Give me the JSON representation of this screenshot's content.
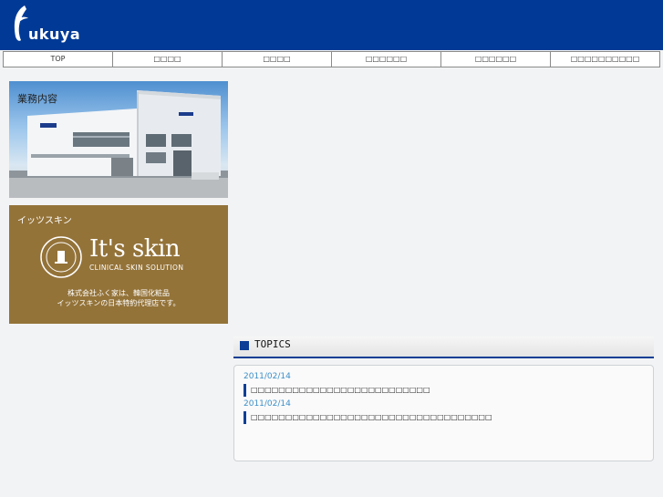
{
  "brand": {
    "logo_text": "ukuya"
  },
  "nav": {
    "items": [
      {
        "label": "TOP"
      },
      {
        "label": "□□□□"
      },
      {
        "label": "□□□□"
      },
      {
        "label": "□□□□□□"
      },
      {
        "label": "□□□□□□"
      },
      {
        "label": "□□□□□□□□□□"
      }
    ]
  },
  "banners": [
    {
      "label": "業務内容"
    },
    {
      "label": "イッツスキン",
      "brand_name": "It's skin",
      "brand_tagline": "CLINICAL SKIN SOLUTION",
      "caption_line1": "株式会社ふく家は、韓国化粧品",
      "caption_line2": "イッツスキンの日本特約代理店です。"
    }
  ],
  "topics": {
    "heading": "TOPICS",
    "entries": [
      {
        "date": "2011/02/14",
        "title": "□□□□□□□□□□□□□□□□□□□□□□□□□□"
      },
      {
        "date": "2011/02/14",
        "title": "□□□□□□□□□□□□□□□□□□□□□□□□□□□□□□□□□□□"
      }
    ]
  },
  "colors": {
    "header_blue": "#003a96",
    "accent_blue": "#0c3f95",
    "date_blue": "#3d8fc7",
    "banner_gold": "#947339"
  }
}
